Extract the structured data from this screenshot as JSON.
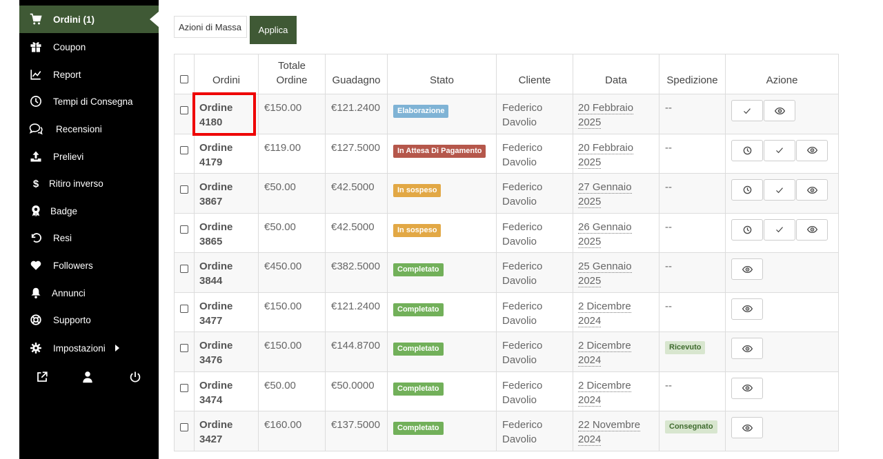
{
  "sidebar": {
    "items": [
      {
        "label": "Ordini (1)",
        "icon": "cart-icon",
        "name": "sidebar-item-ordini"
      },
      {
        "label": "Coupon",
        "icon": "gift-icon",
        "name": "sidebar-item-coupon"
      },
      {
        "label": "Report",
        "icon": "chart-line-icon",
        "name": "sidebar-item-report"
      },
      {
        "label": "Tempi di Consegna",
        "icon": "clock-icon",
        "name": "sidebar-item-tempi-di-consegna"
      },
      {
        "label": "Recensioni",
        "icon": "comments-icon",
        "name": "sidebar-item-recensioni"
      },
      {
        "label": "Prelievi",
        "icon": "upload-icon",
        "name": "sidebar-item-prelievi"
      },
      {
        "label": "Ritiro inverso",
        "icon": "dollar-icon",
        "name": "sidebar-item-ritiro-inverso"
      },
      {
        "label": "Badge",
        "icon": "award-icon",
        "name": "sidebar-item-badge"
      },
      {
        "label": "Resi",
        "icon": "undo-icon",
        "name": "sidebar-item-resi"
      },
      {
        "label": "Followers",
        "icon": "heart-icon",
        "name": "sidebar-item-followers"
      },
      {
        "label": "Annunci",
        "icon": "bell-icon",
        "name": "sidebar-item-annunci"
      },
      {
        "label": "Supporto",
        "icon": "lifebuoy-icon",
        "name": "sidebar-item-supporto"
      },
      {
        "label": "Impostazioni",
        "icon": "gear-icon",
        "name": "sidebar-item-impostazioni"
      }
    ],
    "bottom_icons": [
      "external-link-icon",
      "user-icon",
      "power-icon"
    ]
  },
  "toolbar": {
    "bulk_actions_label": "Azioni di Massa",
    "apply_label": "Applica"
  },
  "table": {
    "headers": {
      "ordini": "Ordini",
      "totale": "Totale Ordine",
      "guadagno": "Guadagno",
      "stato": "Stato",
      "cliente": "Cliente",
      "data": "Data",
      "spedizione": "Spedizione",
      "azione": "Azione"
    },
    "rows": [
      {
        "order": "Ordine 4180",
        "total": "€150.00",
        "earning": "€121.2400",
        "status": "Elaborazione",
        "status_color": "#7fb3d5",
        "client": "Federico Davolio",
        "date": "20 Febbraio 2025",
        "shipping": "--",
        "actions": [
          "check-icon",
          "eye-icon"
        ]
      },
      {
        "order": "Ordine 4179",
        "total": "€119.00",
        "earning": "€127.5000",
        "status": "In Attesa Di Pagamento",
        "status_color": "#b5574b",
        "client": "Federico Davolio",
        "date": "20 Febbraio 2025",
        "shipping": "--",
        "actions": [
          "clock-icon",
          "check-icon",
          "eye-icon"
        ]
      },
      {
        "order": "Ordine 3867",
        "total": "€50.00",
        "earning": "€42.5000",
        "status": "In sospeso",
        "status_color": "#e2a845",
        "client": "Federico Davolio",
        "date": "27 Gennaio 2025",
        "shipping": "--",
        "actions": [
          "clock-icon",
          "check-icon",
          "eye-icon"
        ]
      },
      {
        "order": "Ordine 3865",
        "total": "€50.00",
        "earning": "€42.5000",
        "status": "In sospeso",
        "status_color": "#e2a845",
        "client": "Federico Davolio",
        "date": "26 Gennaio 2025",
        "shipping": "--",
        "actions": [
          "clock-icon",
          "check-icon",
          "eye-icon"
        ]
      },
      {
        "order": "Ordine 3844",
        "total": "€450.00",
        "earning": "€382.5000",
        "status": "Completato",
        "status_color": "#72b05a",
        "client": "Federico Davolio",
        "date": "25 Gennaio 2025",
        "shipping": "--",
        "actions": [
          "eye-icon"
        ]
      },
      {
        "order": "Ordine 3477",
        "total": "€150.00",
        "earning": "€121.2400",
        "status": "Completato",
        "status_color": "#72b05a",
        "client": "Federico Davolio",
        "date": "2 Dicembre 2024",
        "shipping": "--",
        "actions": [
          "eye-icon"
        ]
      },
      {
        "order": "Ordine 3476",
        "total": "€150.00",
        "earning": "€144.8700",
        "status": "Completato",
        "status_color": "#72b05a",
        "client": "Federico Davolio",
        "date": "2 Dicembre 2024",
        "shipping": "Ricevuto",
        "actions": [
          "eye-icon"
        ]
      },
      {
        "order": "Ordine 3474",
        "total": "€50.00",
        "earning": "€50.0000",
        "status": "Completato",
        "status_color": "#72b05a",
        "client": "Federico Davolio",
        "date": "2 Dicembre 2024",
        "shipping": "--",
        "actions": [
          "eye-icon"
        ]
      },
      {
        "order": "Ordine 3427",
        "total": "€160.00",
        "earning": "€137.5000",
        "status": "Completato",
        "status_color": "#72b05a",
        "client": "Federico Davolio",
        "date": "22 Novembre 2024",
        "shipping": "Consegnato",
        "actions": [
          "eye-icon"
        ]
      }
    ]
  },
  "colors": {
    "accent": "#3f5935",
    "highlight": "#e00000"
  }
}
